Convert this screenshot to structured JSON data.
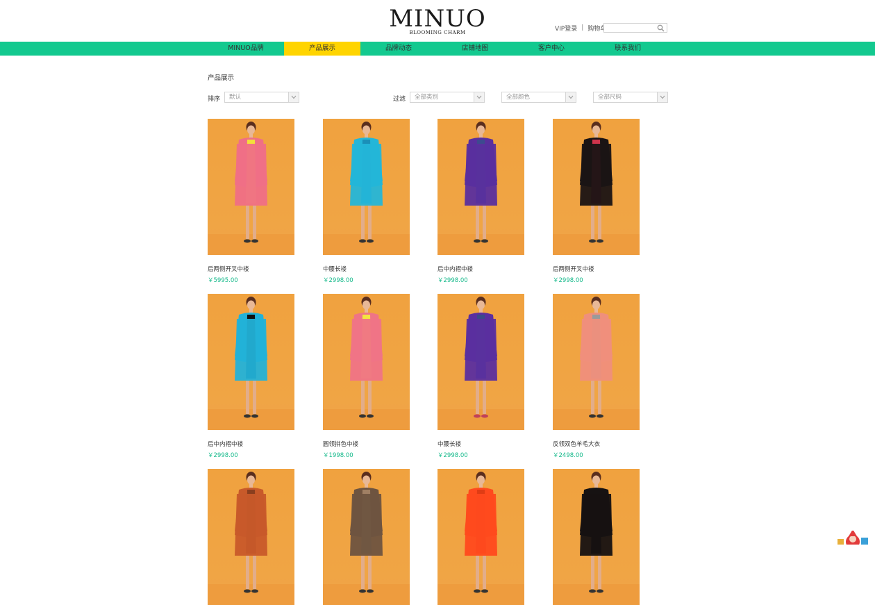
{
  "logo": {
    "brand": "MINUO",
    "tagline": "BLOOMING CHARM"
  },
  "util": {
    "vip": "VIP登录",
    "separator": "|",
    "cart": "购物车"
  },
  "search": {
    "placeholder": ""
  },
  "nav": [
    {
      "label": "MINUO品牌",
      "active": false
    },
    {
      "label": "产品展示",
      "active": true
    },
    {
      "label": "品牌动态",
      "active": false
    },
    {
      "label": "店铺地图",
      "active": false
    },
    {
      "label": "客户中心",
      "active": false
    },
    {
      "label": "联系我们",
      "active": false
    }
  ],
  "section": {
    "title": "产品展示"
  },
  "controls": {
    "sort_label": "排序",
    "sort_value": "默认",
    "filter_label": "过滤",
    "category_value": "全部类别",
    "color_value": "全部颜色",
    "size_value": "全部尺码"
  },
  "colors": {
    "nav_bg": "#13c98f",
    "nav_active": "#ffd400",
    "price": "#14b98a",
    "photo_bg": "#f0a23f"
  },
  "products": [
    {
      "name": "后两侧开叉中褛",
      "price": "￥5995.00",
      "garment": "#ef6f86",
      "inner": "#f3e03a",
      "shoes": "#333"
    },
    {
      "name": "中腰长褛",
      "price": "￥2998.00",
      "garment": "#24b6d8",
      "inner": "#1a8fb8",
      "shoes": "#333"
    },
    {
      "name": "后中内褶中褛",
      "price": "￥2998.00",
      "garment": "#5a2f9e",
      "inner": "#3d4a8f",
      "shoes": "#333"
    },
    {
      "name": "后两侧开叉中褛",
      "price": "￥2998.00",
      "garment": "#1a1414",
      "inner": "#d0344c",
      "shoes": "#333"
    },
    {
      "name": "后中内褶中褛",
      "price": "￥2998.00",
      "garment": "#23b2d8",
      "inner": "#111111",
      "shoes": "#333"
    },
    {
      "name": "圆领拼色中褛",
      "price": "￥1998.00",
      "garment": "#ef7486",
      "inner": "#f3e640",
      "shoes": "#333"
    },
    {
      "name": "中腰长褛",
      "price": "￥2998.00",
      "garment": "#5b2f9f",
      "inner": "#3a4b8a",
      "shoes": "#c0405a"
    },
    {
      "name": "反领双色羊毛大衣",
      "price": "￥2498.00",
      "garment": "#ef8f7c",
      "inner": "#9a9a9a",
      "shoes": "#333"
    },
    {
      "name": "",
      "price": "",
      "garment": "#c85a2a",
      "inner": "#8a3e1e",
      "shoes": "#333"
    },
    {
      "name": "",
      "price": "",
      "garment": "#6e5440",
      "inner": "#a08064",
      "shoes": "#333"
    },
    {
      "name": "",
      "price": "",
      "garment": "#ff4a1e",
      "inner": "#e03c14",
      "shoes": "#333"
    },
    {
      "name": "",
      "price": "",
      "garment": "#161212",
      "inner": "#161212",
      "shoes": "#333"
    }
  ]
}
